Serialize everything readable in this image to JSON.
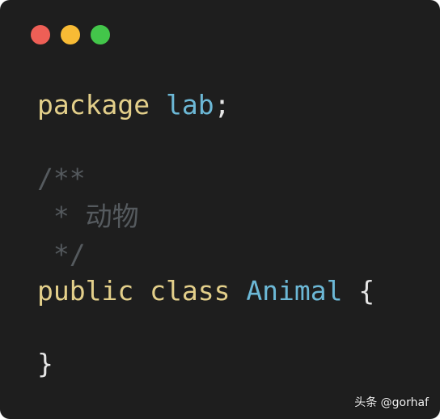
{
  "window": {
    "dots": [
      {
        "name": "close",
        "color": "#ee5f56"
      },
      {
        "name": "minimize",
        "color": "#f8bb35"
      },
      {
        "name": "maximize",
        "color": "#43c64a"
      }
    ]
  },
  "code": {
    "package_kw": "package",
    "package_name": "lab",
    "package_semicolon": ";",
    "comment_open": "/**",
    "comment_body": " * 动物",
    "comment_close": " */",
    "public_kw": "public",
    "class_kw": "class",
    "class_name": "Animal",
    "open_brace": "{",
    "close_brace": "}"
  },
  "watermark": "头条 @gorhaf",
  "colors": {
    "background": "#1e1e1e",
    "keyword": "#e3cf8a",
    "identifier": "#6cb8d6",
    "punctuation": "#e6e6e6",
    "comment": "#555a5e"
  }
}
